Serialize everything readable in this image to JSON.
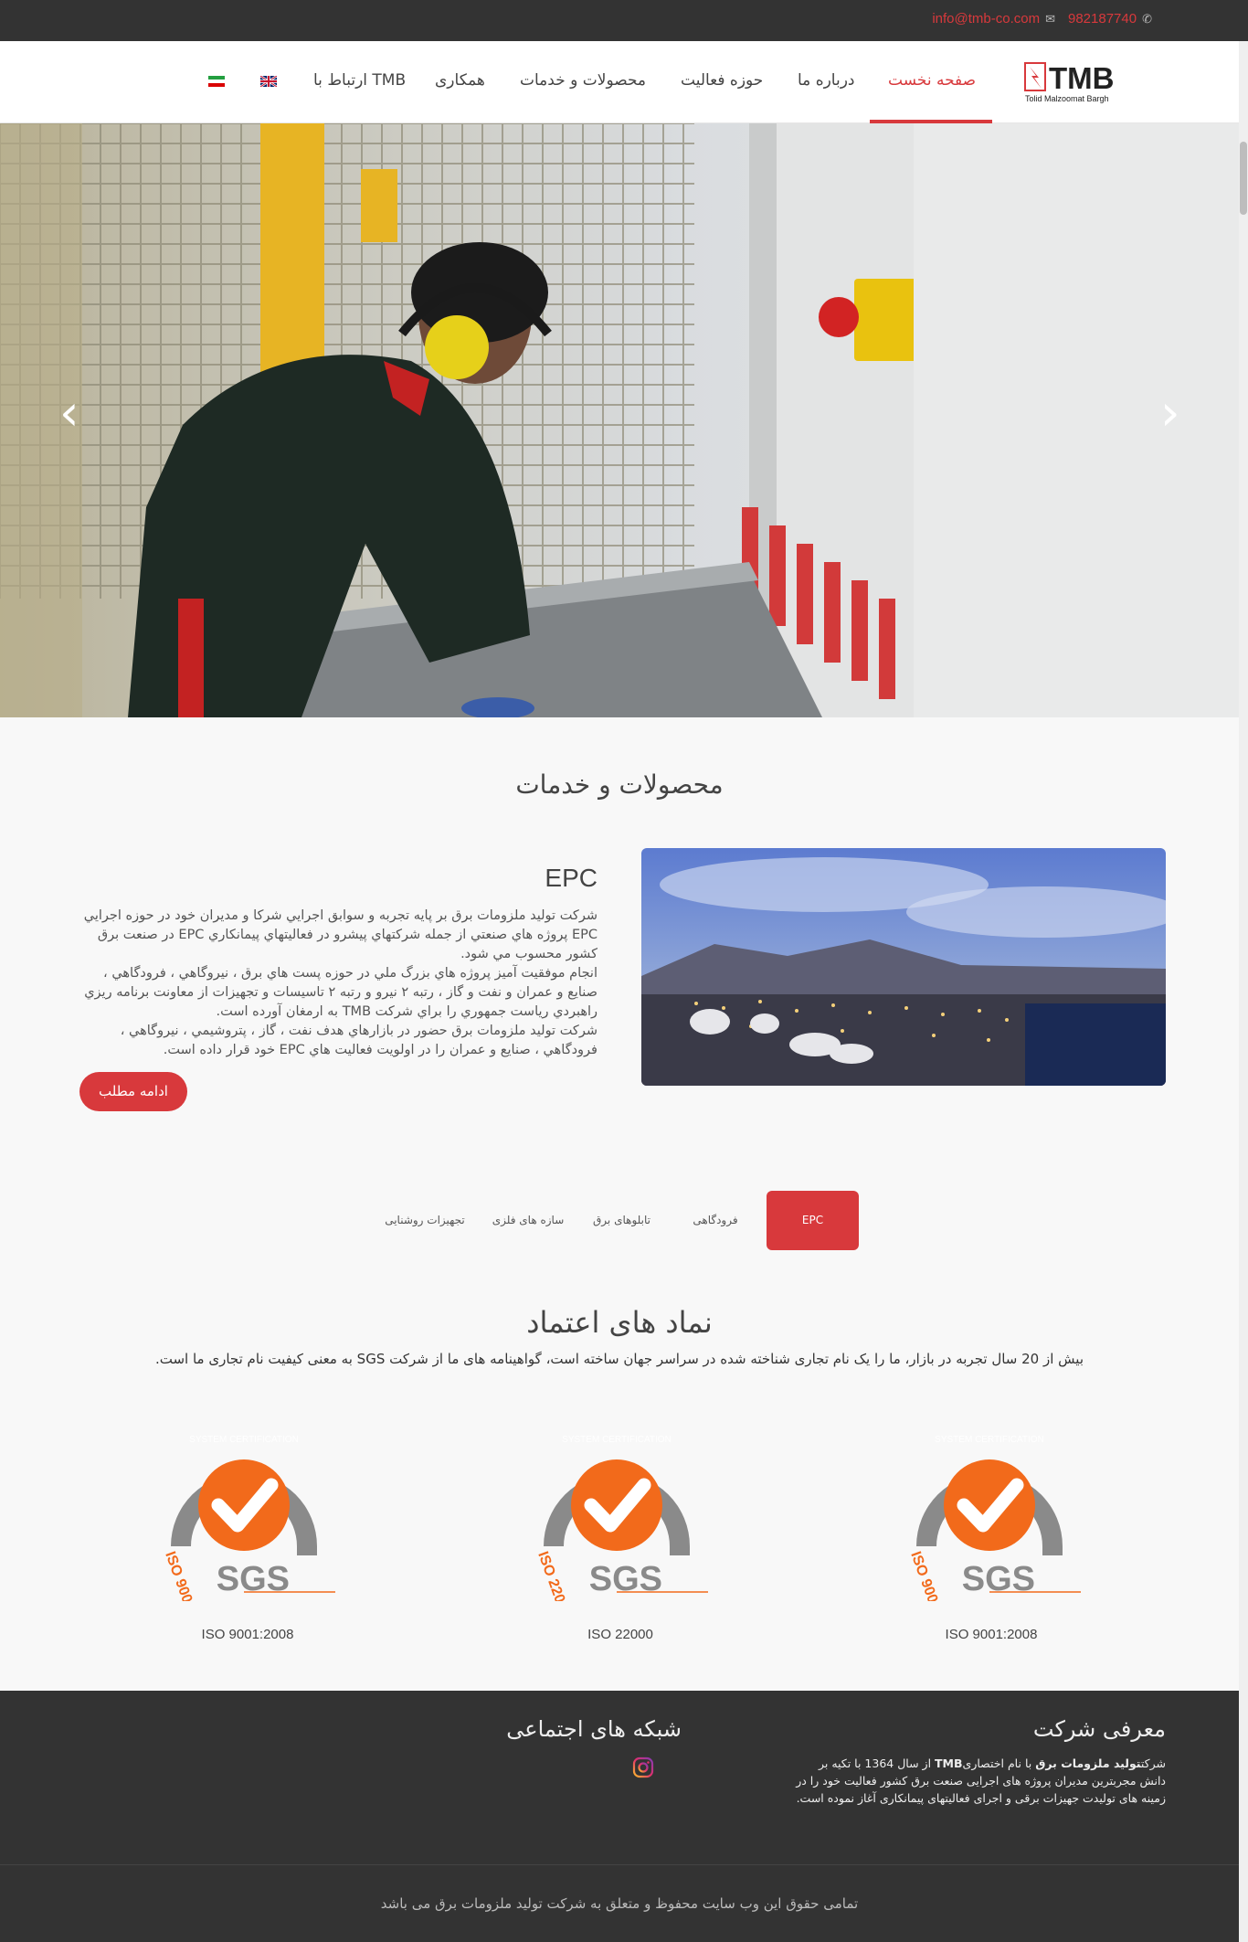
{
  "topbar": {
    "phone": "982187740",
    "email": "info@tmb-co.com"
  },
  "logo": {
    "brand": "TMB",
    "tagline": "Tolid Malzoomat Bargh"
  },
  "nav": {
    "items": [
      {
        "label": "صفحه نخست",
        "active": true
      },
      {
        "label": "درباره ما"
      },
      {
        "label": "حوزه فعالیت"
      },
      {
        "label": "محصولات و خدمات"
      },
      {
        "label": "همکاری"
      },
      {
        "label": "ارتباط با TMB"
      }
    ],
    "flags": [
      "english-flag-icon",
      "iran-flag-icon"
    ]
  },
  "hero": {
    "prev_arrow": "‹",
    "next_arrow": "›"
  },
  "products": {
    "title": "محصولات و خدمات",
    "epc_title": "EPC",
    "epc_paragraphs": [
      "شرکت تولید ملزومات برق بر پایه تجربه و سوابق اجرایي شرکا و مدیران خود در حوزه اجرایي EPC پروژه هاي صنعتي از جمله شرکتهاي پیشرو در فعالیتهاي پیمانکاري EPC در صنعت برق کشور محسوب مي شود.",
      "انجام موفقیت آمیز پروژه هاي بزرگ ملي در حوزه پست هاي برق ، نیروگاهي ، فرودگاهي ، صنایع و عمران و نفت و گاز ، رتبه ۲ نیرو و رتبه ۲ تاسیسات و تجهیزات از معاونت برنامه ریزي راهبردي ریاست جمهوري را براي شرکت TMB به ارمغان آورده است.",
      "شرکت تولید ملزومات برق حضور در بازارهاي هدف نفت ، گاز ، پتروشیمي ، نیروگاهي ، فرودگاهي ، صنایع و عمران را در اولویت فعالیت هاي EPC خود قرار داده است."
    ],
    "more_button": "ادامه مطلب",
    "tabs": [
      "EPC",
      "فرودگاهی",
      "تابلوهای برق",
      "سازه های فلزی",
      "تجهیزات روشنایی"
    ]
  },
  "trust": {
    "title": "نماد های اعتماد",
    "subtitle": "بیش از 20 سال تجربه در بازار، ما را یک نام تجاری شناخته شده در سراسر جهان ساخته است، گواهینامه های ما از شرکت SGS به معنی کیفیت نام تجاری ما است.",
    "certs": [
      {
        "label": "ISO 9001:2008",
        "ring_text": "SYSTEM CERTIFICATION",
        "iso_text": "ISO 9001:2008",
        "brand": "SGS"
      },
      {
        "label": "ISO 22000",
        "ring_text": "SYSTEM CERTIFICATION",
        "iso_text": "ISO 22000",
        "brand": "SGS"
      },
      {
        "label": "ISO 9001:2008",
        "ring_text": "SYSTEM CERTIFICATION",
        "iso_text": "ISO 9001:2008",
        "brand": "SGS"
      }
    ]
  },
  "footer": {
    "about_title": "معرفی شرکت",
    "about_text_pre": "شرکت",
    "about_text_bold": "تولید ملزومات برق",
    "about_text_mid": " با نام اختصاری",
    "about_text_bold2": "TMB",
    "about_text_post": " از سال 1364 با تکیه بر دانش مجربترین مدیران پروژه های اجرایی صنعت برق کشور فعالیت خود را در زمینه های تولیدت جهیزات برقی و اجرای فعالیتهای پیمانکاری آغاز نموده است.",
    "social_title": "شبکه های اجتماعی",
    "copyright": "تمامی حقوق این وب سایت محفوظ و متعلق به شرکت تولید ملزومات برق می باشد"
  },
  "colors": {
    "accent": "#d8393c",
    "dark": "#333333",
    "cert_orange": "#f26a1b",
    "cert_gray": "#8a8a8a"
  }
}
